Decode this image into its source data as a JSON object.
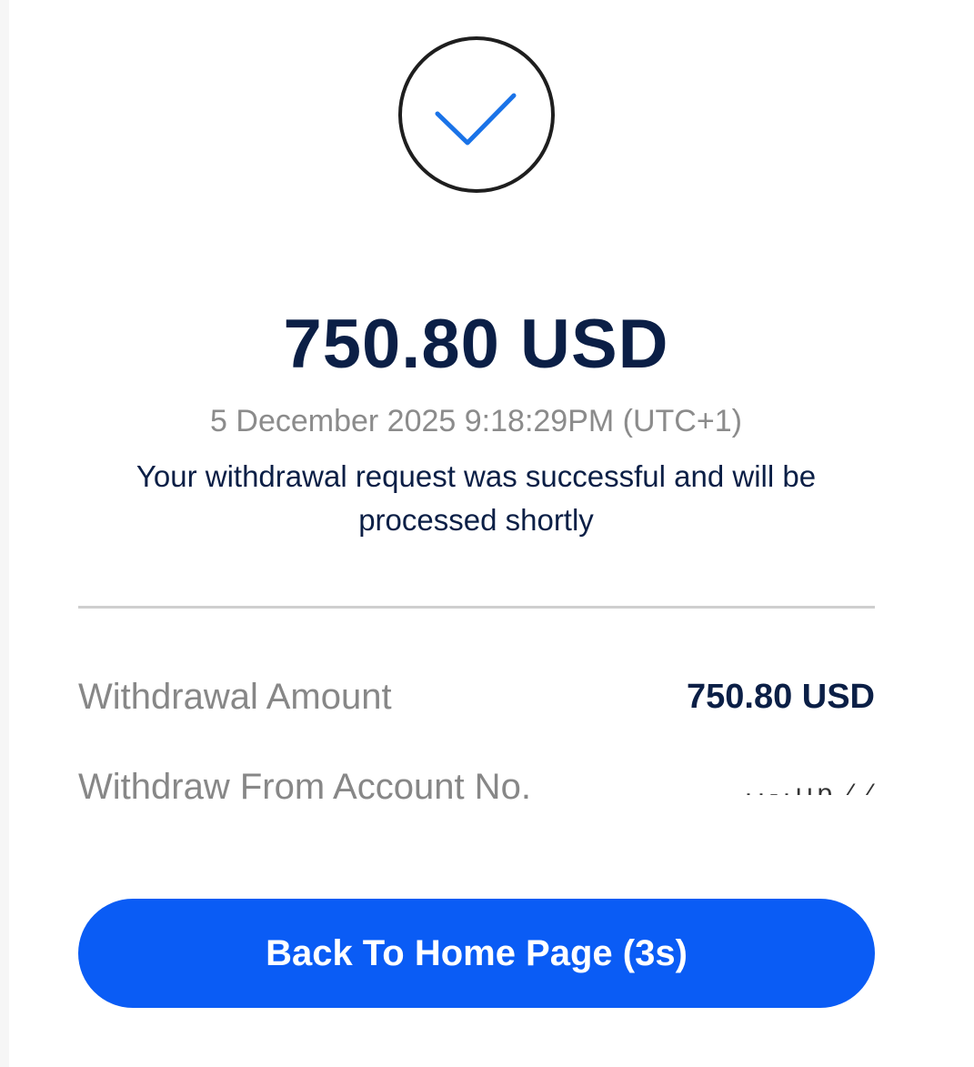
{
  "colors": {
    "accent": "#0a5cf5",
    "check": "#1a73e8",
    "heading": "#0b1f46",
    "muted": "#878787"
  },
  "icons": {
    "success": "checkmark-circle-icon"
  },
  "summary": {
    "amount": "750.80 USD",
    "timestamp": "5 December 2025 9:18:29PM (UTC+1)",
    "message": "Your withdrawal request was successful and will be processed shortly"
  },
  "details": {
    "withdrawal_amount_label": "Withdrawal Amount",
    "withdrawal_amount_value": "750.80 USD",
    "account_label": "Withdraw From Account No.",
    "account_value": "··-·ııɒ ⁄ ⁄"
  },
  "actions": {
    "home_button_label": "Back To Home Page (3s)",
    "countdown_seconds": 3
  }
}
